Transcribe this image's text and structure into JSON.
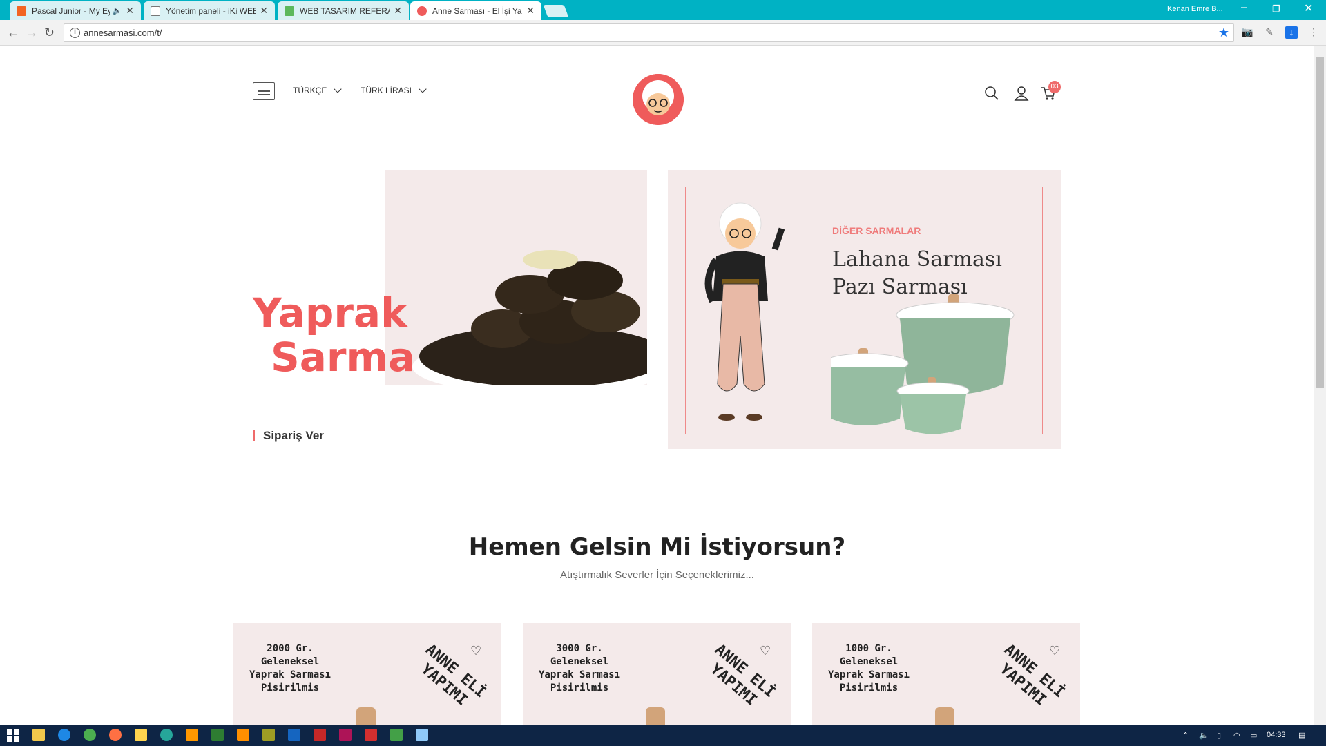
{
  "browser": {
    "tabs": [
      {
        "title": "Pascal Junior - My Eye",
        "active": false
      },
      {
        "title": "Yönetim paneli - iKi WEB",
        "active": false
      },
      {
        "title": "WEB TASARIM REFERANS",
        "active": false
      },
      {
        "title": "Anne Sarması - El İşi Yapı",
        "active": true
      }
    ],
    "user": "Kenan Emre B...",
    "url": "annesarmasi.com/t/"
  },
  "header": {
    "language": "TÜRKÇE",
    "currency": "TÜRK LİRASI",
    "cart_count": "03"
  },
  "hero": {
    "title_line1": "Yaprak",
    "title_line2": "Sarma",
    "cta": "Sipariş Ver"
  },
  "promo": {
    "kicker": "DİĞER SARMALAR",
    "line1": "Lahana Sarması",
    "line2": "Pazı Sarması"
  },
  "section": {
    "title": "Hemen Gelsin Mi İstiyorsun?",
    "subtitle": "Atıştırmalık Severler İçin Seçeneklerimiz..."
  },
  "products": [
    {
      "desc": "2000 Gr.\nGeleneksel\nYaprak Sarması\nPisirilmis",
      "stamp": "ANNE ELİ\nYAPIMI"
    },
    {
      "desc": "3000 Gr.\nGeleneksel\nYaprak Sarması\nPisirilmis",
      "stamp": "ANNE ELİ\nYAPIMI"
    },
    {
      "desc": "1000 Gr.\nGeleneksel\nYaprak Sarması\nPisirilmis",
      "stamp": "ANNE ELİ\nYAPIMI"
    }
  ],
  "taskbar": {
    "time": "04:33"
  },
  "colors": {
    "accent": "#ef5b5b",
    "chrome_bar": "#00b2c4",
    "panel_bg": "#f4eaea",
    "taskbar": "#0e2545"
  }
}
